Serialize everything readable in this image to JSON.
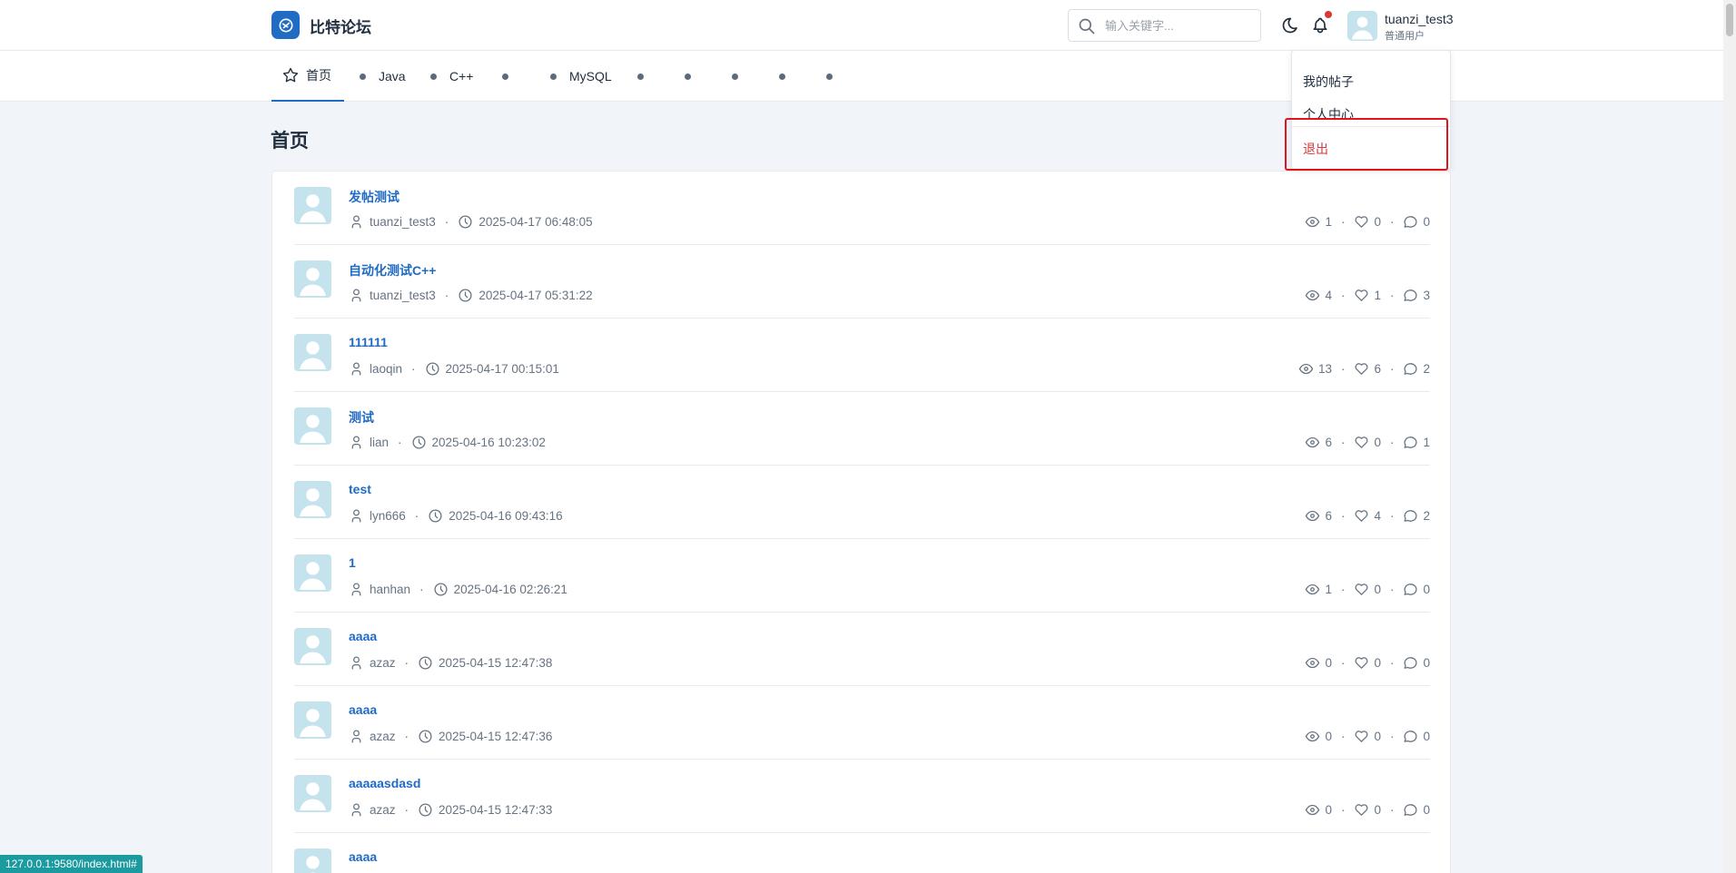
{
  "header": {
    "brand": "比特论坛",
    "search_placeholder": "输入关键字...",
    "user": {
      "name": "tuanzi_test3",
      "role": "普通用户"
    }
  },
  "nav": {
    "home_label": "首页",
    "items": [
      "Java",
      "C++",
      "",
      "MySQL",
      "",
      "",
      "",
      "",
      ""
    ]
  },
  "page": {
    "title": "首页"
  },
  "posts": [
    {
      "title": "发帖测试",
      "author": "tuanzi_test3",
      "time": "2025-04-17 06:48:05",
      "views": "1",
      "likes": "0",
      "comments": "0"
    },
    {
      "title": "自动化测试C++",
      "author": "tuanzi_test3",
      "time": "2025-04-17 05:31:22",
      "views": "4",
      "likes": "1",
      "comments": "3"
    },
    {
      "title": "111111",
      "author": "laoqin",
      "time": "2025-04-17 00:15:01",
      "views": "13",
      "likes": "6",
      "comments": "2"
    },
    {
      "title": "测试",
      "author": "lian",
      "time": "2025-04-16 10:23:02",
      "views": "6",
      "likes": "0",
      "comments": "1"
    },
    {
      "title": "test",
      "author": "lyn666",
      "time": "2025-04-16 09:43:16",
      "views": "6",
      "likes": "4",
      "comments": "2"
    },
    {
      "title": "1",
      "author": "hanhan",
      "time": "2025-04-16 02:26:21",
      "views": "1",
      "likes": "0",
      "comments": "0"
    },
    {
      "title": "aaaa",
      "author": "azaz",
      "time": "2025-04-15 12:47:38",
      "views": "0",
      "likes": "0",
      "comments": "0"
    },
    {
      "title": "aaaa",
      "author": "azaz",
      "time": "2025-04-15 12:47:36",
      "views": "0",
      "likes": "0",
      "comments": "0"
    },
    {
      "title": "aaaaasdasd",
      "author": "azaz",
      "time": "2025-04-15 12:47:33",
      "views": "0",
      "likes": "0",
      "comments": "0"
    },
    {
      "title": "aaaa",
      "author": "",
      "time": "",
      "views": "",
      "likes": "",
      "comments": ""
    }
  ],
  "dropdown": {
    "my_posts": "我的帖子",
    "profile": "个人中心",
    "logout": "退出"
  },
  "status_url": "127.0.0.1:9580/index.html#",
  "colors": {
    "primary": "#206bc4",
    "danger": "#d63939",
    "highlight_box": "#e0141b",
    "avatar_bg": "#c5e3ec"
  }
}
